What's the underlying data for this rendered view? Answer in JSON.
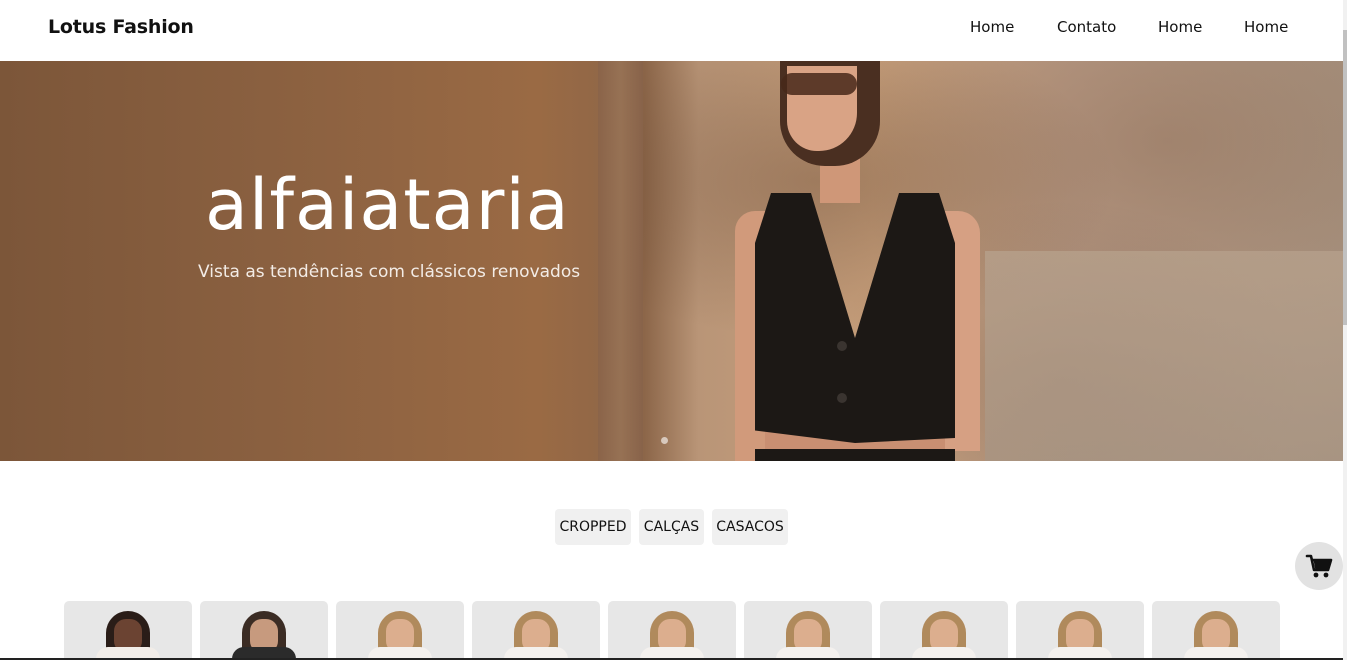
{
  "brand": "Lotus Fashion",
  "nav": {
    "links": [
      "Home",
      "Contato",
      "Home",
      "Home"
    ]
  },
  "hero": {
    "title": "alfaiataria",
    "subtitle": "Vista as tendências com clássicos renovados"
  },
  "categories": [
    "CROPPED",
    "CALÇAS",
    "CASACOS"
  ],
  "cart": {
    "icon": "cart-icon"
  },
  "products": {
    "count_visible": 9
  },
  "colors": {
    "hero_brown": "#8a6040",
    "button_bg": "#f0f0f0",
    "cart_bg": "#e2e2e2"
  }
}
